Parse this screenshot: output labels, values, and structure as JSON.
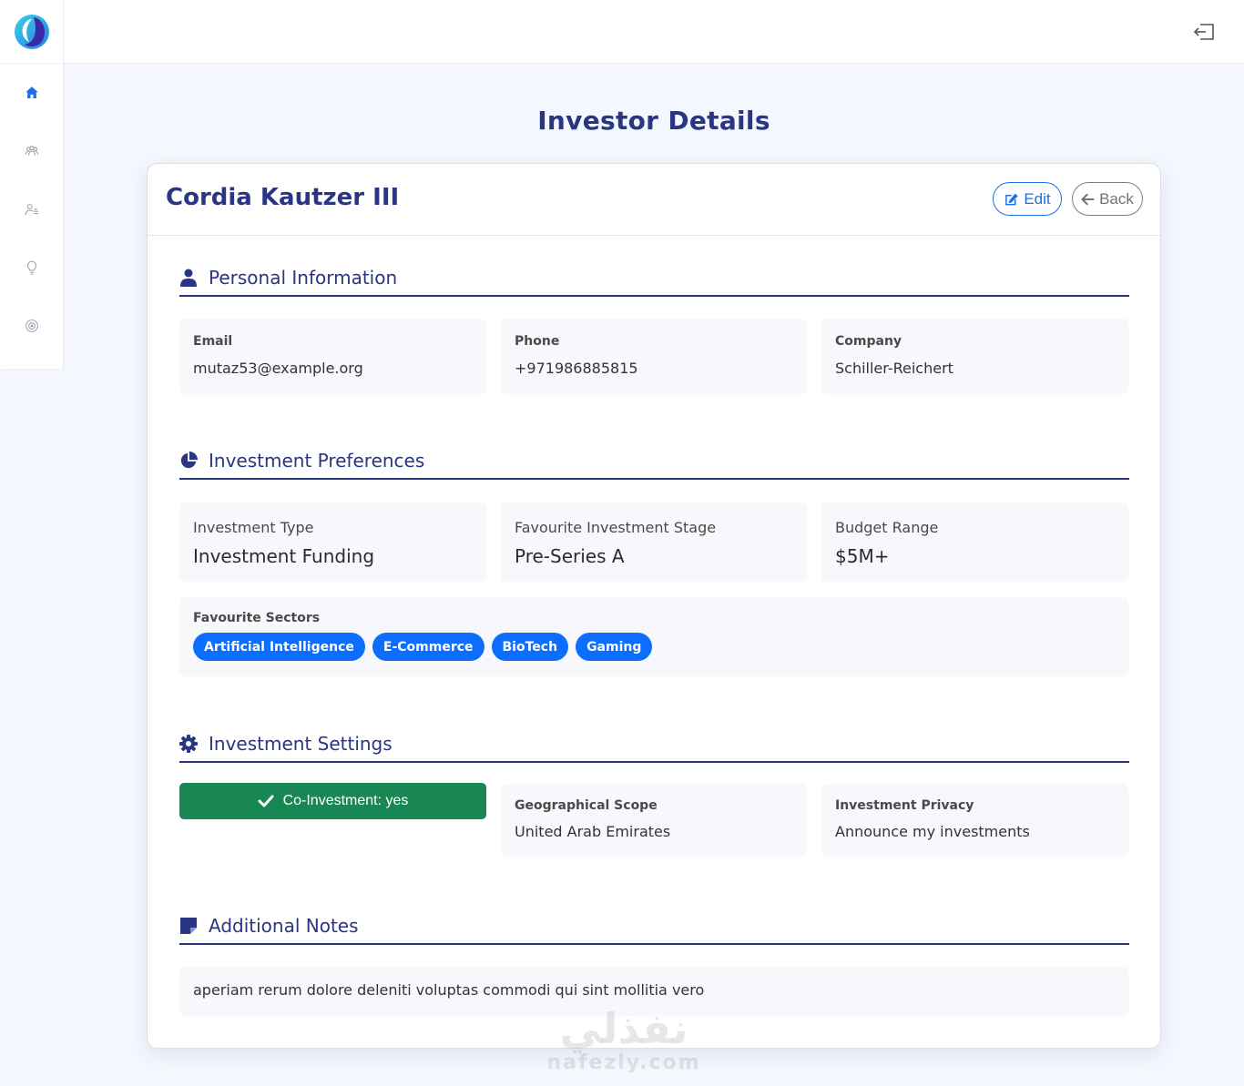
{
  "sidebar": {
    "items": [
      {
        "icon": "home-icon",
        "active": true
      },
      {
        "icon": "users-icon",
        "active": false
      },
      {
        "icon": "user-list-icon",
        "active": false
      },
      {
        "icon": "lightbulb-icon",
        "active": false
      },
      {
        "icon": "target-icon",
        "active": false
      }
    ]
  },
  "page": {
    "title": "Investor Details"
  },
  "investor": {
    "name": "Cordia Kautzer III",
    "edit_label": "Edit",
    "back_label": "Back"
  },
  "personal": {
    "title": "Personal Information",
    "email_label": "Email",
    "email": "mutaz53@example.org",
    "phone_label": "Phone",
    "phone": "+971986885815",
    "company_label": "Company",
    "company": "Schiller-Reichert"
  },
  "preferences": {
    "title": "Investment Preferences",
    "type_label": "Investment Type",
    "type": "Investment Funding",
    "stage_label": "Favourite Investment Stage",
    "stage": "Pre-Series A",
    "budget_label": "Budget Range",
    "budget": "$5M+",
    "sectors_label": "Favourite Sectors",
    "sectors": [
      "Artificial Intelligence",
      "E-Commerce",
      "BioTech",
      "Gaming"
    ]
  },
  "settings": {
    "title": "Investment Settings",
    "coinvestment": "Co-Investment: yes",
    "scope_label": "Geographical Scope",
    "scope": "United Arab Emirates",
    "privacy_label": "Investment Privacy",
    "privacy": "Announce my investments"
  },
  "notes": {
    "title": "Additional Notes",
    "text": "aperiam rerum dolore deleniti voluptas commodi qui sint mollitia vero"
  },
  "watermark": {
    "arabic": "نفذلي",
    "latin": "nafezly.com"
  },
  "colors": {
    "primary": "#2a3584",
    "accent": "#0d6efd",
    "success": "#198754",
    "background": "#f4f7fd"
  }
}
